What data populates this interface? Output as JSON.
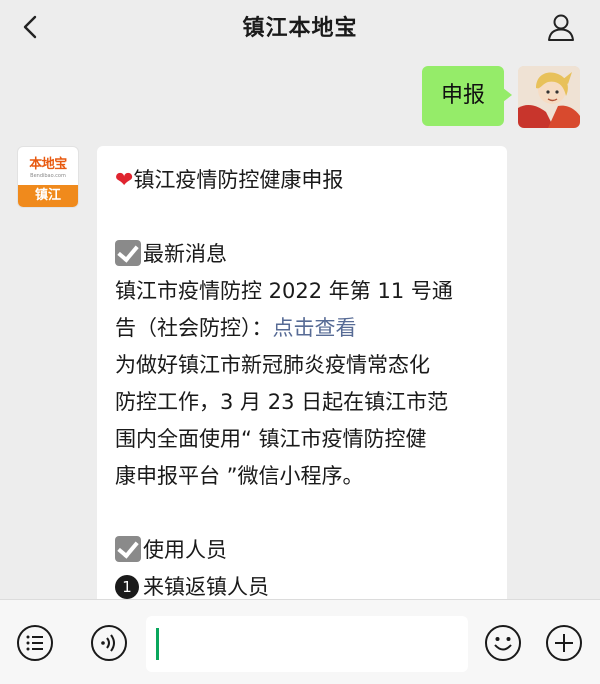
{
  "nav": {
    "title": "镇江本地宝",
    "back_icon": "chevron-left-icon",
    "profile_icon": "person-icon"
  },
  "outgoing": {
    "text": "申报"
  },
  "bot_avatar": {
    "logo_top": "本地宝",
    "logo_url": "Bendibao.com",
    "logo_bottom": "镇江"
  },
  "message": {
    "heading": "镇江疫情防控健康申报",
    "section1_title": "最新消息",
    "notice_line1": "镇江市疫情防控 2022 年第 11 号通",
    "notice_line2_prefix": "告（社会防控）：",
    "notice_link": "点击查看",
    "body_line1": "为做好镇江市新冠肺炎疫情常态化",
    "body_line2": "防控工作，3 月 23 日起在镇江市范",
    "body_line3": "围内全面使用“ 镇江市疫情防控健",
    "body_line4": "康申报平台 ”微信小程序。",
    "section2_title": "使用人员",
    "item1_num": "1",
    "item1_text": "来镇返镇人员"
  },
  "toolbar": {
    "menu_icon": "list-icon",
    "voice_icon": "voice-icon",
    "emoji_icon": "emoji-icon",
    "plus_icon": "plus-icon"
  },
  "colors": {
    "outgoing_bubble": "#95ec69",
    "link": "#576b95",
    "caret": "#09a65c",
    "brand_orange": "#f08a1c"
  }
}
